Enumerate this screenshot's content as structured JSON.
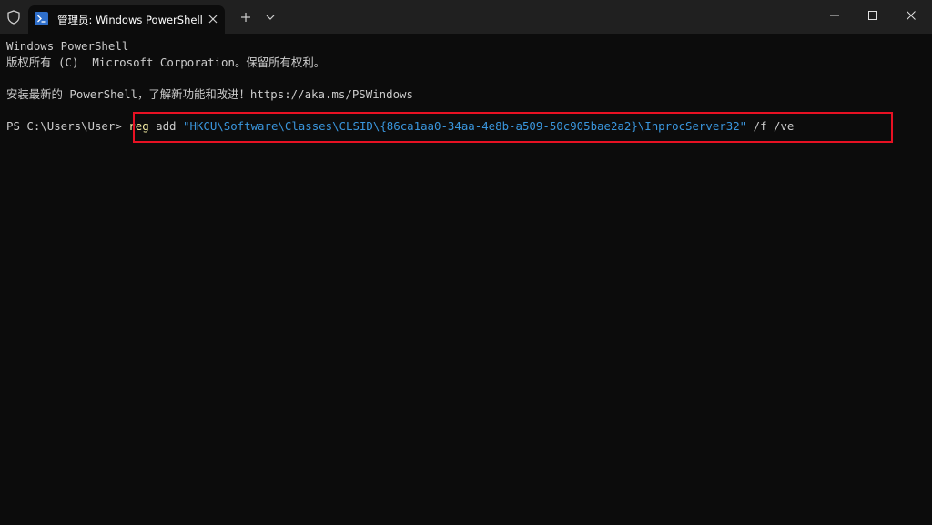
{
  "titlebar": {
    "tab_title": "管理员: Windows PowerShell",
    "icons": {
      "shield": "shield-icon",
      "powershell": "powershell-icon",
      "close_tab": "close-icon",
      "new_tab": "plus-icon",
      "dropdown": "chevron-down-icon",
      "minimize": "minimize-icon",
      "maximize": "maximize-icon",
      "close_window": "close-icon"
    }
  },
  "terminal": {
    "header_line": "Windows PowerShell",
    "copyright_line": "版权所有 (C)  Microsoft Corporation。保留所有权利。",
    "install_line": "安装最新的 PowerShell，了解新功能和改进！https://aka.ms/PSWindows",
    "prompt": "PS C:\\Users\\User> ",
    "command": {
      "cmdlet": "reg",
      "subcommand": " add ",
      "path": "\"HKCU\\Software\\Classes\\CLSID\\{86ca1aa0-34aa-4e8b-a509-50c905bae2a2}\\InprocServer32\"",
      "flags": " /f /ve"
    }
  },
  "colors": {
    "background": "#0c0c0c",
    "titlebar": "#202020",
    "text": "#cccccc",
    "command": "#f9f1a5",
    "string": "#3a96dd",
    "highlight": "#e81123"
  }
}
